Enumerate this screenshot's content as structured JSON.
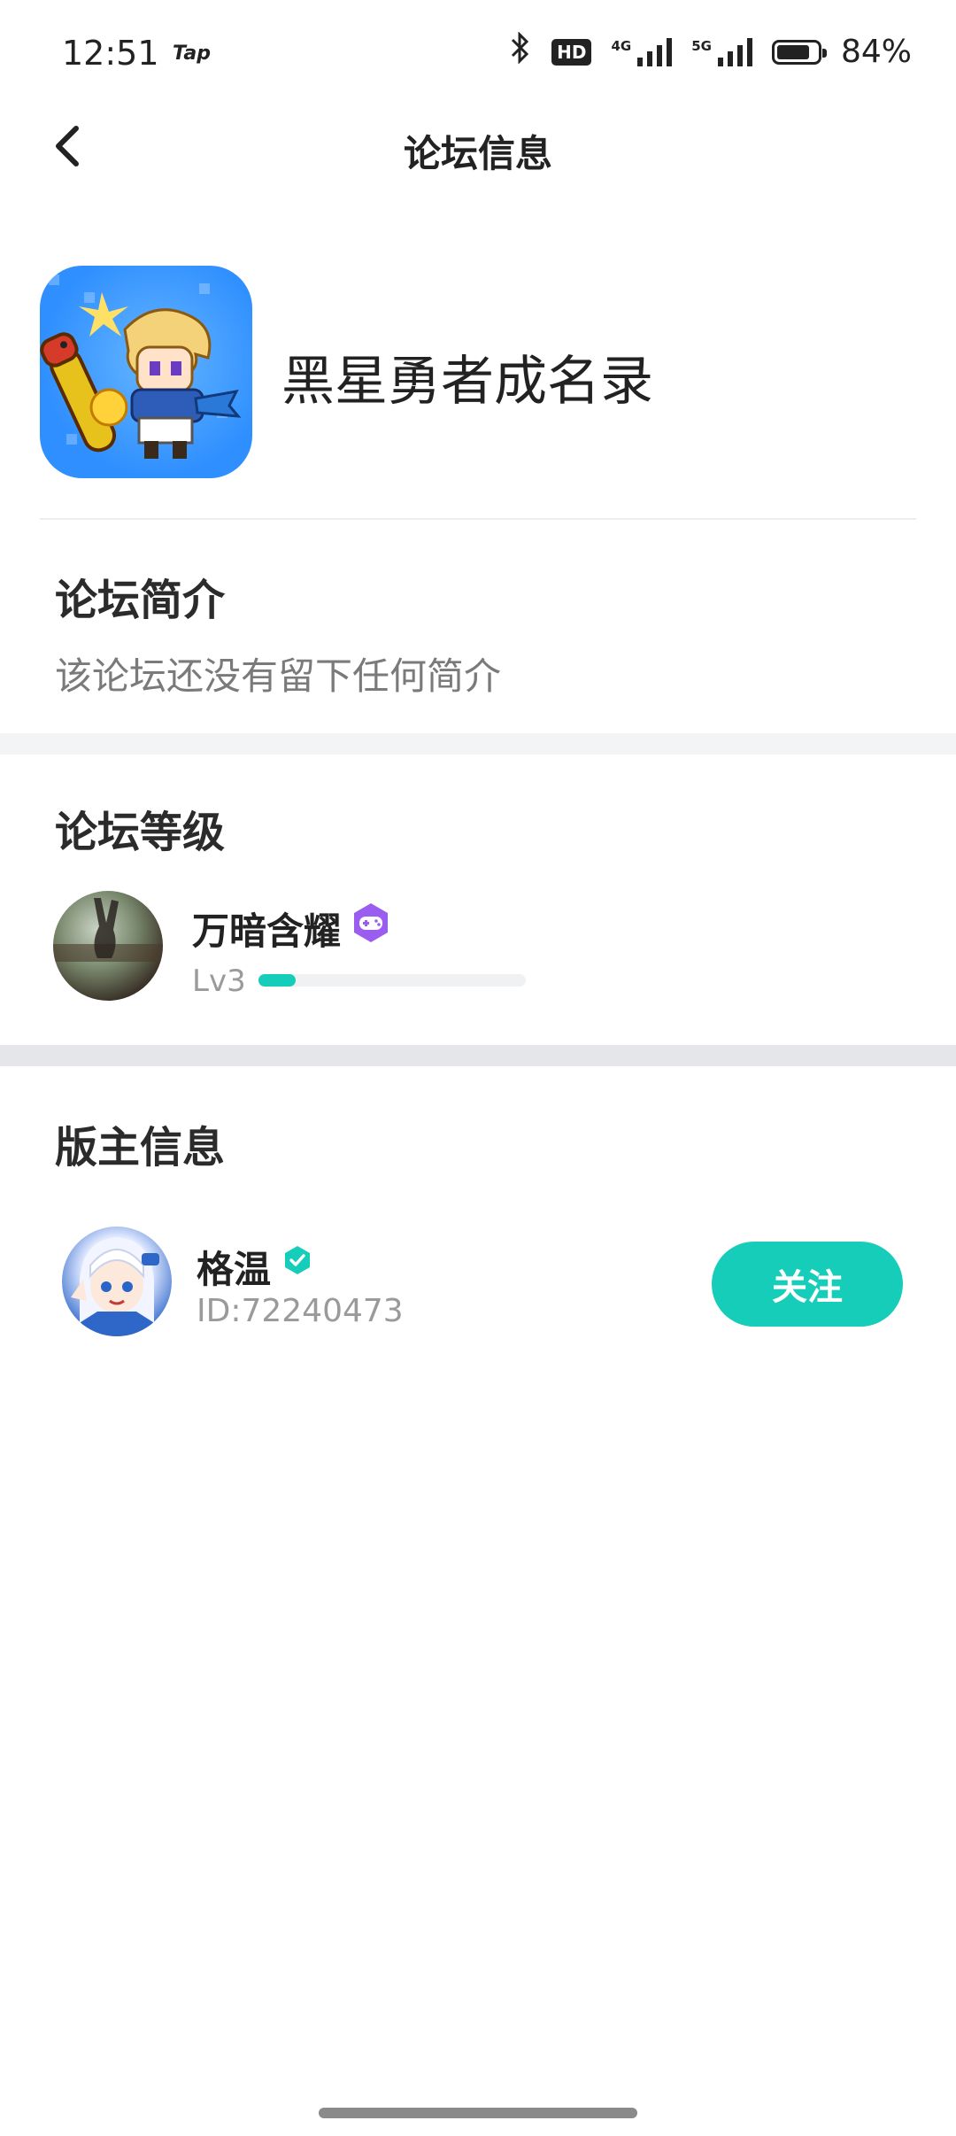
{
  "status_bar": {
    "time": "12:51",
    "app_badge": "Tap",
    "battery_percent": "84%",
    "battery_level": 0.84,
    "hd_label": "HD",
    "net1": "4G",
    "net2": "5G"
  },
  "header": {
    "title": "论坛信息",
    "back_icon": "chevron-left-icon"
  },
  "forum": {
    "name": "黑星勇者成名录",
    "icon": "game-icon"
  },
  "intro": {
    "title": "论坛简介",
    "text": "该论坛还没有留下任何简介"
  },
  "level": {
    "title": "论坛等级",
    "user_name": "万暗含耀",
    "badge_icon": "game-controller-badge-icon",
    "level_label": "Lv3",
    "progress": 0.14
  },
  "moderator": {
    "title": "版主信息",
    "name": "格温",
    "id_text": "ID:72240473",
    "verified_icon": "verified-icon",
    "follow_label": "关注"
  },
  "colors": {
    "accent": "#16cdb9",
    "badge_purple": "#9b5cf0",
    "text_primary": "#222222",
    "text_secondary": "#9a9a9a"
  }
}
